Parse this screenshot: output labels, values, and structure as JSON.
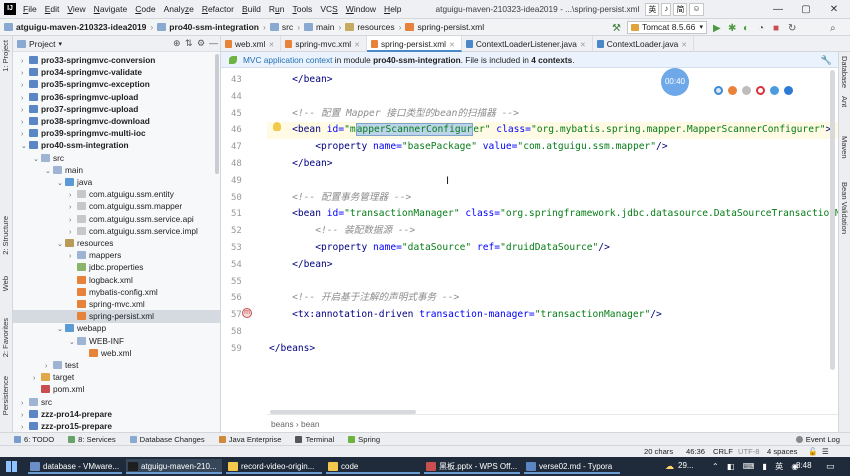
{
  "menu": {
    "items": [
      {
        "pre": "",
        "u": "F",
        "post": "ile"
      },
      {
        "pre": "",
        "u": "E",
        "post": "dit"
      },
      {
        "pre": "",
        "u": "V",
        "post": "iew"
      },
      {
        "pre": "",
        "u": "N",
        "post": "avigate"
      },
      {
        "pre": "",
        "u": "C",
        "post": "ode"
      },
      {
        "pre": "Analy",
        "u": "z",
        "post": "e"
      },
      {
        "pre": "",
        "u": "R",
        "post": "efactor"
      },
      {
        "pre": "",
        "u": "B",
        "post": "uild"
      },
      {
        "pre": "R",
        "u": "u",
        "post": "n"
      },
      {
        "pre": "",
        "u": "T",
        "post": "ools"
      },
      {
        "pre": "VC",
        "u": "S",
        "post": ""
      },
      {
        "pre": "",
        "u": "W",
        "post": "indow"
      },
      {
        "pre": "",
        "u": "H",
        "post": "elp"
      }
    ],
    "window_title": "atguigu-maven-210323-idea2019 - ...\\spring-persist.xml",
    "ime": [
      "英",
      "♪",
      "简",
      "☺"
    ]
  },
  "navbar": {
    "crumbs": [
      "atguigu-maven-210323-idea2019",
      "pro40-ssm-integration",
      "src",
      "main",
      "resources",
      "spring-persist.xml"
    ],
    "run_config": "Tomcat 8.5.66"
  },
  "left_strip": {
    "tabs": [
      "1: Project",
      "2: Structure",
      "Web",
      "2: Favorites",
      "Persistence"
    ]
  },
  "right_strip": {
    "tabs": [
      "Database",
      "Ant",
      "Maven",
      "Bean Validation"
    ]
  },
  "project": {
    "header": "Project",
    "rows": [
      {
        "indent": 1,
        "arrow": "›",
        "label": "pro33-springmvc-conversion",
        "bold": true,
        "icon": "module"
      },
      {
        "indent": 1,
        "arrow": "›",
        "label": "pro34-springmvc-validate",
        "bold": true,
        "icon": "module"
      },
      {
        "indent": 1,
        "arrow": "›",
        "label": "pro35-springmvc-exception",
        "bold": true,
        "icon": "module"
      },
      {
        "indent": 1,
        "arrow": "›",
        "label": "pro36-springmvc-upload",
        "bold": true,
        "icon": "module"
      },
      {
        "indent": 1,
        "arrow": "›",
        "label": "pro37-springmvc-upload",
        "bold": true,
        "icon": "module"
      },
      {
        "indent": 1,
        "arrow": "›",
        "label": "pro38-springmvc-download",
        "bold": true,
        "icon": "module"
      },
      {
        "indent": 1,
        "arrow": "›",
        "label": "pro39-springmvc-multi-ioc",
        "bold": true,
        "icon": "module"
      },
      {
        "indent": 1,
        "arrow": "⌄",
        "label": "pro40-ssm-integration",
        "bold": true,
        "icon": "module"
      },
      {
        "indent": 2,
        "arrow": "⌄",
        "label": "src",
        "bold": false,
        "icon": "folder"
      },
      {
        "indent": 3,
        "arrow": "⌄",
        "label": "main",
        "bold": false,
        "icon": "folder"
      },
      {
        "indent": 4,
        "arrow": "⌄",
        "label": "java",
        "bold": false,
        "icon": "src-folder"
      },
      {
        "indent": 5,
        "arrow": "›",
        "label": "com.atguigu.ssm.entity",
        "bold": false,
        "icon": "package"
      },
      {
        "indent": 5,
        "arrow": "›",
        "label": "com.atguigu.ssm.mapper",
        "bold": false,
        "icon": "package"
      },
      {
        "indent": 5,
        "arrow": "›",
        "label": "com.atguigu.ssm.service.api",
        "bold": false,
        "icon": "package"
      },
      {
        "indent": 5,
        "arrow": "›",
        "label": "com.atguigu.ssm.service.impl",
        "bold": false,
        "icon": "package"
      },
      {
        "indent": 4,
        "arrow": "⌄",
        "label": "resources",
        "bold": false,
        "icon": "res-folder"
      },
      {
        "indent": 5,
        "arrow": "›",
        "label": "mappers",
        "bold": false,
        "icon": "folder"
      },
      {
        "indent": 5,
        "arrow": "",
        "label": "jdbc.properties",
        "bold": false,
        "icon": "props"
      },
      {
        "indent": 5,
        "arrow": "",
        "label": "logback.xml",
        "bold": false,
        "icon": "xml"
      },
      {
        "indent": 5,
        "arrow": "",
        "label": "mybatis-config.xml",
        "bold": false,
        "icon": "xml"
      },
      {
        "indent": 5,
        "arrow": "",
        "label": "spring-mvc.xml",
        "bold": false,
        "icon": "xml"
      },
      {
        "indent": 5,
        "arrow": "",
        "label": "spring-persist.xml",
        "bold": false,
        "icon": "xml",
        "selected": true
      },
      {
        "indent": 4,
        "arrow": "⌄",
        "label": "webapp",
        "bold": false,
        "icon": "web-folder"
      },
      {
        "indent": 5,
        "arrow": "⌄",
        "label": "WEB-INF",
        "bold": false,
        "icon": "folder"
      },
      {
        "indent": 6,
        "arrow": "",
        "label": "web.xml",
        "bold": false,
        "icon": "xml"
      },
      {
        "indent": 3,
        "arrow": "›",
        "label": "test",
        "bold": false,
        "icon": "folder"
      },
      {
        "indent": 2,
        "arrow": "›",
        "label": "target",
        "bold": false,
        "icon": "target-folder"
      },
      {
        "indent": 2,
        "arrow": "",
        "label": "pom.xml",
        "bold": false,
        "icon": "maven"
      },
      {
        "indent": 1,
        "arrow": "›",
        "label": "src",
        "bold": false,
        "icon": "folder"
      },
      {
        "indent": 1,
        "arrow": "›",
        "label": "zzz-pro14-prepare",
        "bold": true,
        "icon": "module"
      },
      {
        "indent": 1,
        "arrow": "›",
        "label": "zzz-pro15-prepare",
        "bold": true,
        "icon": "module"
      }
    ]
  },
  "editor_tabs": [
    {
      "label": "web.xml",
      "active": false
    },
    {
      "label": "spring-mvc.xml",
      "active": false
    },
    {
      "label": "spring-persist.xml",
      "active": true
    },
    {
      "label": "ContextLoaderListener.java",
      "active": false
    },
    {
      "label": "ContextLoader.java",
      "active": false
    }
  ],
  "banner": {
    "link": "MVC application context",
    "text": " in module ",
    "module": "pro40-ssm-integration",
    "text2": ". File is included in ",
    "count": "4 contexts",
    "text3": "."
  },
  "code": {
    "lines": [
      {
        "no": "43",
        "indent": 1,
        "parts": [
          {
            "t": "</bean>",
            "c": "tag"
          }
        ]
      },
      {
        "no": "44",
        "indent": 0,
        "parts": []
      },
      {
        "no": "45",
        "indent": 1,
        "parts": [
          {
            "t": "<!-- 配置 Mapper 接口类型的bean的扫描器 -->",
            "c": "cmt"
          }
        ]
      },
      {
        "no": "46",
        "indent": 1,
        "current": true,
        "parts": [
          {
            "t": "<bean ",
            "c": "tag"
          },
          {
            "t": "id=",
            "c": "attr"
          },
          {
            "t": "\"m",
            "c": "val"
          },
          {
            "t": "apperScannerConfigur",
            "c": "val hl"
          },
          {
            "t": "er\" ",
            "c": "val"
          },
          {
            "t": "class=",
            "c": "attr"
          },
          {
            "t": "\"org.mybatis.spring.mapper.MapperScannerConfigurer\"",
            "c": "val"
          },
          {
            "t": ">",
            "c": "tag"
          }
        ]
      },
      {
        "no": "47",
        "indent": 2,
        "parts": [
          {
            "t": "<property ",
            "c": "tag"
          },
          {
            "t": "name=",
            "c": "attr"
          },
          {
            "t": "\"basePackage\" ",
            "c": "val"
          },
          {
            "t": "value=",
            "c": "attr"
          },
          {
            "t": "\"com.atguigu.ssm.mapper\"",
            "c": "val"
          },
          {
            "t": "/>",
            "c": "tag"
          }
        ]
      },
      {
        "no": "48",
        "indent": 1,
        "parts": [
          {
            "t": "</bean>",
            "c": "tag"
          }
        ]
      },
      {
        "no": "49",
        "indent": 0,
        "parts": []
      },
      {
        "no": "50",
        "indent": 1,
        "parts": [
          {
            "t": "<!-- 配置事务管理器 -->",
            "c": "cmt"
          }
        ]
      },
      {
        "no": "51",
        "indent": 1,
        "parts": [
          {
            "t": "<bean ",
            "c": "tag"
          },
          {
            "t": "id=",
            "c": "attr"
          },
          {
            "t": "\"transactionManager\" ",
            "c": "val"
          },
          {
            "t": "class=",
            "c": "attr"
          },
          {
            "t": "\"org.springframework.jdbc.datasource.DataSourceTransactionManager\"",
            "c": "val"
          },
          {
            "t": ">",
            "c": "tag"
          }
        ]
      },
      {
        "no": "52",
        "indent": 2,
        "parts": [
          {
            "t": "<!-- 装配数据源 -->",
            "c": "cmt"
          }
        ]
      },
      {
        "no": "53",
        "indent": 2,
        "parts": [
          {
            "t": "<property ",
            "c": "tag"
          },
          {
            "t": "name=",
            "c": "attr"
          },
          {
            "t": "\"dataSource\" ",
            "c": "val"
          },
          {
            "t": "ref=",
            "c": "attr"
          },
          {
            "t": "\"druidDataSource\"",
            "c": "val"
          },
          {
            "t": "/>",
            "c": "tag"
          }
        ]
      },
      {
        "no": "54",
        "indent": 1,
        "parts": [
          {
            "t": "</bean>",
            "c": "tag"
          }
        ]
      },
      {
        "no": "55",
        "indent": 0,
        "parts": []
      },
      {
        "no": "56",
        "indent": 1,
        "parts": [
          {
            "t": "<!-- 开启基于注解的声明式事务 -->",
            "c": "cmt"
          }
        ]
      },
      {
        "no": "57",
        "indent": 1,
        "parts": [
          {
            "t": "<tx:annotation-driven ",
            "c": "tag"
          },
          {
            "t": "transaction-manager=",
            "c": "attr"
          },
          {
            "t": "\"transactionManager\"",
            "c": "val"
          },
          {
            "t": "/>",
            "c": "tag"
          }
        ]
      },
      {
        "no": "58",
        "indent": 0,
        "parts": []
      },
      {
        "no": "59",
        "indent": 0,
        "parts": [
          {
            "t": "</beans>",
            "c": "tag"
          }
        ]
      }
    ],
    "breadcrumb": "beans  ›  bean"
  },
  "overlay": {
    "timer": "00:40"
  },
  "tool_tabs": [
    "6: TODO",
    "8: Services",
    "Database Changes",
    "Java Enterprise",
    "Terminal",
    "Spring"
  ],
  "event_log": "Event Log",
  "status": {
    "chars": "20 chars",
    "position": "46:36",
    "line_sep": "CRLF",
    "encoding": "UTF-8",
    "indent": "4 spaces"
  },
  "taskbar": {
    "tasks": [
      "database - VMware...",
      "atguigu-maven-210...",
      "record-video-origin...",
      "code",
      "黑板.pptx - WPS Off...",
      "verse02.md - Typora"
    ],
    "weather": "29...",
    "time": "8:48"
  },
  "colors": {
    "accent": "#4a88c7",
    "tag": "#000080",
    "attr": "#0000ff",
    "value": "#067d17",
    "comment": "#8c8c8c"
  }
}
